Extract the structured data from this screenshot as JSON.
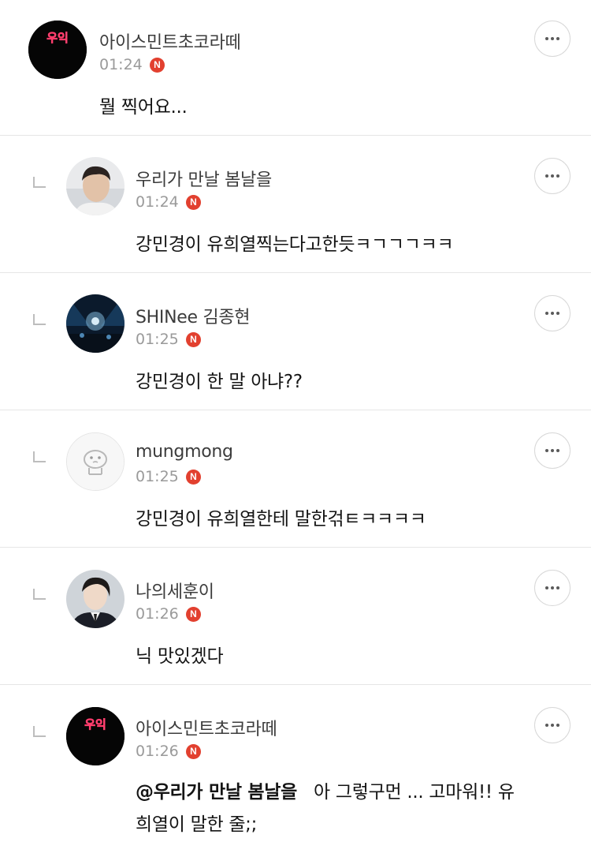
{
  "comments": [
    {
      "nickname": "아이스민트초코라떼",
      "time": "01:24",
      "badge": "N",
      "text": "뭘 찍어요...",
      "avatar_icon": "avatar-uik-icon",
      "avatar_text": "우익"
    },
    {
      "nickname": "우리가 만날 봄날을",
      "time": "01:24",
      "badge": "N",
      "text": "강민경이 유희열찍는다고한듯ㅋㄱㄱㄱㅋㅋ",
      "avatar_icon": "avatar-person-photo-icon"
    },
    {
      "nickname": "SHINee 김종현",
      "time": "01:25",
      "badge": "N",
      "text": "강민경이 한 말 아냐??",
      "avatar_icon": "avatar-concert-photo-icon"
    },
    {
      "nickname": "mungmong",
      "time": "01:25",
      "badge": "N",
      "text": "강민경이 유희열한테 말한걲ㅌㅋㅋㅋㅋ",
      "avatar_icon": "avatar-default-character-icon"
    },
    {
      "nickname": "나의세훈이",
      "time": "01:26",
      "badge": "N",
      "text": "닉 맛있겠다",
      "avatar_icon": "avatar-person-suit-photo-icon"
    },
    {
      "nickname": "아이스민트초코라떼",
      "time": "01:26",
      "badge": "N",
      "mention": "@우리가 만날 봄날을",
      "text_line1": "아 그렇구먼 ... 고마워!! 유",
      "text_line2": "희열이 말한 줄;;",
      "avatar_icon": "avatar-uik-icon",
      "avatar_text": "우익"
    }
  ],
  "colors": {
    "badge": "#e2402f",
    "divider": "#e6e6e6",
    "nickname": "#3c3c3c",
    "time": "#9a9a9a"
  }
}
